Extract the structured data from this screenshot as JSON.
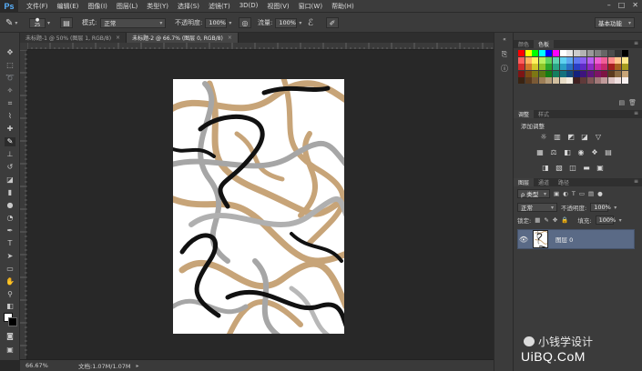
{
  "app": {
    "logo": "Ps"
  },
  "menu": [
    "文件(F)",
    "编辑(E)",
    "图像(I)",
    "图层(L)",
    "类型(Y)",
    "选择(S)",
    "滤镜(T)",
    "3D(D)",
    "视图(V)",
    "窗口(W)",
    "帮助(H)"
  ],
  "window_controls": {
    "minimize": "–",
    "maximize": "□",
    "close": "✕"
  },
  "options": {
    "brush_size": "25",
    "mode_label": "模式:",
    "mode_value": "正常",
    "opacity_label": "不透明度:",
    "opacity_value": "100%",
    "flow_label": "流量:",
    "flow_value": "100%",
    "workspace": "基本功能"
  },
  "tabs": [
    {
      "label": "未标题-1 @ 50% (图层 1, RGB/8)",
      "active": false
    },
    {
      "label": "未标题-2 @ 66.7% (图层 0, RGB/8)",
      "active": true
    }
  ],
  "status": {
    "zoom": "66.67%",
    "doc": "文档:1.07M/1.07M"
  },
  "panels": {
    "color_tab": "颜色",
    "swatches_tab": "色板",
    "adjustments_tab": "调整",
    "styles_tab": "样式",
    "adj_title": "添加调整",
    "layers_tab": "图层",
    "channels_tab": "通道",
    "paths_tab": "路径",
    "kind_label": "ρ 类型",
    "blend_mode": "正常",
    "opacity_label": "不透明度:",
    "opacity_value": "100%",
    "lock_label": "锁定:",
    "fill_label": "填充:",
    "fill_value": "100%",
    "layer_name": "图层 0"
  },
  "swatch_colors": [
    "#ff0000",
    "#ffff00",
    "#00ff00",
    "#00ffff",
    "#0000ff",
    "#ff00ff",
    "#ffffff",
    "#e6e6e6",
    "#cccccc",
    "#b3b3b3",
    "#999999",
    "#808080",
    "#666666",
    "#4d4d4d",
    "#333333",
    "#000000",
    "#ff5f5f",
    "#ffb25f",
    "#fff05f",
    "#b8f05f",
    "#5fd25f",
    "#5fd2b0",
    "#5fd2f0",
    "#5fa8f0",
    "#5f78f0",
    "#8a5ff0",
    "#b85ff0",
    "#f05fd2",
    "#f05f96",
    "#ff8c8c",
    "#ffc88c",
    "#ffe98c",
    "#d12a2a",
    "#d1782a",
    "#d1c62a",
    "#8ec62a",
    "#2aa62a",
    "#2aa685",
    "#2a9fc6",
    "#2a6fc6",
    "#2a3fc6",
    "#5f2ac6",
    "#8e2ac6",
    "#c62aa6",
    "#c62a6a",
    "#a61e1e",
    "#a6601e",
    "#a69c1e",
    "#7d1414",
    "#7d4a14",
    "#7d7714",
    "#5a7714",
    "#147d14",
    "#147d5f",
    "#14717d",
    "#14497d",
    "#14217d",
    "#3d147d",
    "#5f147d",
    "#7d1464",
    "#7d1442",
    "#5c3a1e",
    "#8b6a43",
    "#c7a478",
    "#3a2312",
    "#5a3a1f",
    "#7a5a36",
    "#9d7e57",
    "#b59d7a",
    "#d2bf9f",
    "#e8dcc6",
    "#f3ece0",
    "#402020",
    "#603a3a",
    "#805656",
    "#a07878",
    "#c09b9b",
    "#dcc2c2",
    "#efe0e0",
    "#f8f0f0"
  ]
}
